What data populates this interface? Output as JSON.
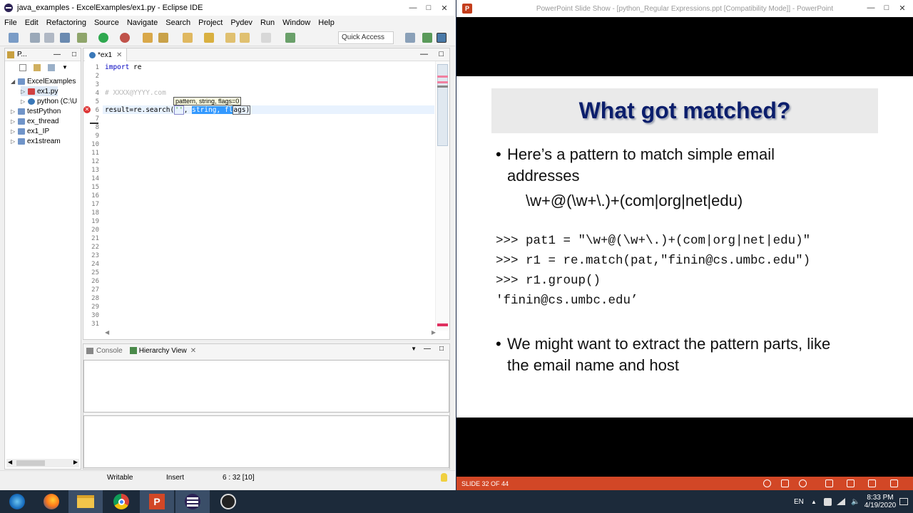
{
  "eclipse": {
    "window_title": "java_examples - ExcelExamples/ex1.py - Eclipse IDE",
    "menu": [
      "File",
      "Edit",
      "Refactoring",
      "Source",
      "Navigate",
      "Search",
      "Project",
      "Pydev",
      "Run",
      "Window",
      "Help"
    ],
    "quick_access": "Quick Access",
    "package_explorer": {
      "tab_label": "P...",
      "items": [
        {
          "label": "ExcelExamples",
          "level": 0,
          "expanded": true
        },
        {
          "label": "ex1.py",
          "level": 1,
          "selected": true
        },
        {
          "label": "python  (C:\\U",
          "level": 1
        },
        {
          "label": "testPython",
          "level": 0
        },
        {
          "label": "ex_thread",
          "level": 0
        },
        {
          "label": "ex1_IP",
          "level": 0
        },
        {
          "label": "ex1stream",
          "level": 0
        }
      ]
    },
    "editor": {
      "tab_label": "*ex1",
      "line_numbers": [
        "1",
        "2",
        "3",
        "4",
        "5",
        "6",
        "7",
        "8",
        "9",
        "10",
        "11",
        "12",
        "13",
        "14",
        "15",
        "16",
        "17",
        "18",
        "19",
        "20",
        "21",
        "22",
        "23",
        "24",
        "25",
        "26",
        "27",
        "28",
        "29",
        "30",
        "31"
      ],
      "code": {
        "line1_kw": "import",
        "line1_rest": " re",
        "line4": "# XXXX@YYYY.com",
        "line6_a": "result=re.search(",
        "line6_b": "''",
        "line6_c": ", ",
        "line6_sel": "string, fl",
        "line6_d": "ags)"
      },
      "tooltip": "pattern, string, flags=0"
    },
    "console": {
      "tabs": [
        "Console",
        "Hierarchy View"
      ]
    },
    "status": {
      "writable": "Writable",
      "mode": "Insert",
      "position": "6 : 32 [10]"
    }
  },
  "powerpoint": {
    "window_title": "PowerPoint Slide Show - [python_Regular Expressions.ppt [Compatibility Mode]] - PowerPoint",
    "slide": {
      "title": "What got matched?",
      "bullet1_line1": "Here’s a pattern to match simple email",
      "bullet1_line2": "addresses",
      "pattern": "\\w+@(\\w+\\.)+(com|org|net|edu)",
      "code": [
        ">>> pat1 = \"\\w+@(\\w+\\.)+(com|org|net|edu)\"",
        ">>> r1 = re.match(pat,\"finin@cs.umbc.edu\")",
        ">>> r1.group()",
        "'finin@cs.umbc.edu’"
      ],
      "bullet2_line1": "We might want to extract the pattern parts, like",
      "bullet2_line2": "the email name and host"
    },
    "status": "SLIDE 32 OF 44"
  },
  "taskbar": {
    "apps": [
      "start-button",
      "firefox",
      "file-explorer",
      "chrome",
      "powerpoint",
      "eclipse",
      "obs"
    ],
    "lang": "EN",
    "time": "8:33 PM",
    "date": "4/19/2020"
  },
  "colors": {
    "ppt_orange": "#d24726",
    "slide_title": "#0b1e6c",
    "taskbar": "#1c2a3a"
  }
}
